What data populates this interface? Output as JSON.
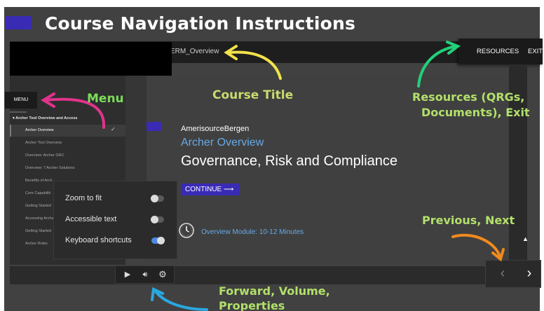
{
  "slide": {
    "title": "Course Navigation Instructions"
  },
  "player": {
    "course_title": "ERM_Overview",
    "resources_label": "RESOURCES",
    "exit_label": "EXIT",
    "menu_label": "MENU",
    "nav": {
      "section": "Archer Tool Overview and Access",
      "items": [
        {
          "label": "Archer Overview",
          "active": true
        },
        {
          "label": "Archer Tool Overview"
        },
        {
          "label": "Overview: Archer GRC"
        },
        {
          "label": "Overview: 7 Archer Solutions"
        },
        {
          "label": "Benefits of Arch"
        },
        {
          "label": "Core Capabiliti"
        },
        {
          "label": "Getting Started"
        },
        {
          "label": "Accessing Arche"
        },
        {
          "label": "Getting Started"
        },
        {
          "label": "Archer Roles"
        }
      ]
    },
    "content": {
      "company": "AmerisourceBergen",
      "lesson": "Archer Overview",
      "subject": "Governance, Risk and Compliance",
      "continue_label": "CONTINUE ⟶",
      "duration": "Overview Module: 10-12 Minutes"
    },
    "settings": [
      {
        "label": "Zoom to fit",
        "on": false
      },
      {
        "label": "Accessible text",
        "on": false
      },
      {
        "label": "Keyboard shortcuts",
        "on": true
      }
    ],
    "controls": {
      "play_icon": "play-icon",
      "volume_icon": "volume-icon",
      "gear_icon": "gear-icon",
      "prev_icon": "chevron-left-icon",
      "next_icon": "chevron-right-icon"
    }
  },
  "annotations": {
    "course_title": "Course Title",
    "menu": "Menu",
    "resources_line1": "Resources (QRGs,",
    "resources_line2": "Documents), Exit",
    "prev_next": "Previous, Next",
    "controls_line1": "Forward, Volume,",
    "controls_line2": "Properties"
  },
  "colors": {
    "accent_purple": "#3a2bb5",
    "link_blue": "#68a9e6",
    "arrow_yellow": "#f2e24a",
    "arrow_magenta": "#e0338c",
    "arrow_green": "#22d07a",
    "arrow_orange": "#f08a1e",
    "arrow_blue": "#29a8e0"
  }
}
